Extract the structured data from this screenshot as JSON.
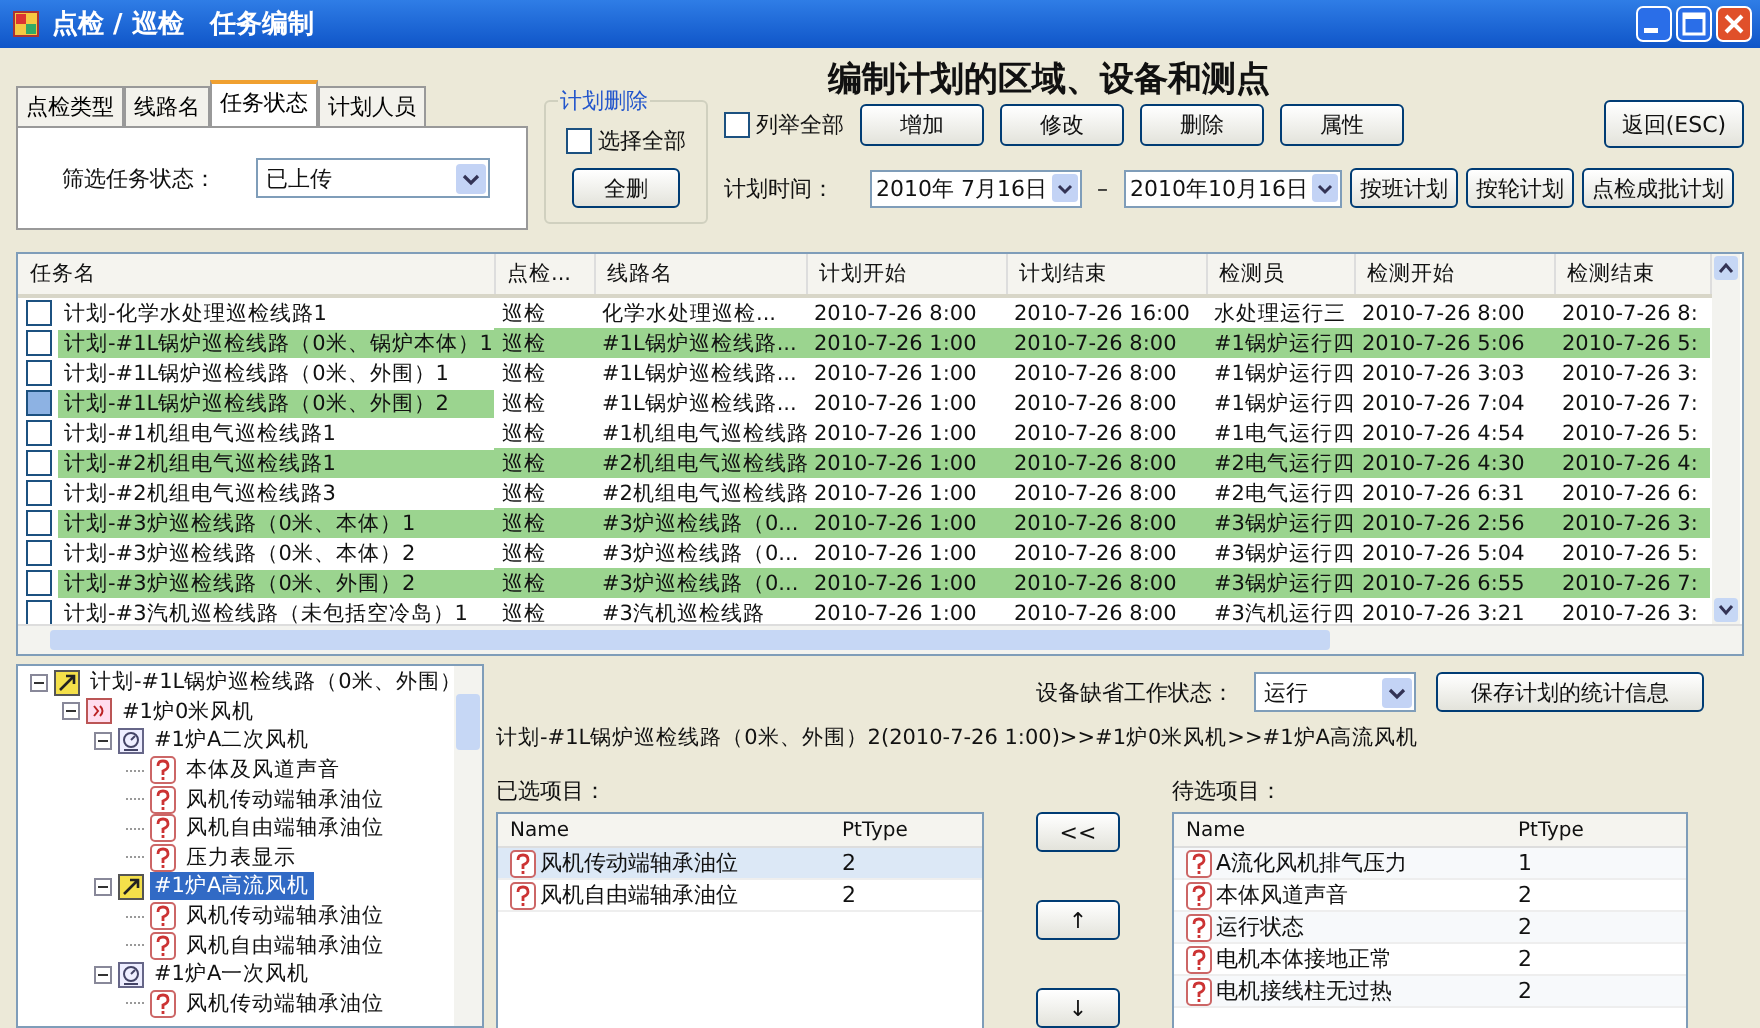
{
  "window": {
    "title": "点检 / 巡检　任务编制"
  },
  "filter_tabs": [
    {
      "label": "点检类型",
      "selected": false
    },
    {
      "label": "线路名",
      "selected": false
    },
    {
      "label": "任务状态",
      "selected": true
    },
    {
      "label": "计划人员",
      "selected": false
    }
  ],
  "filter": {
    "label": "筛选任务状态：",
    "value": "已上传"
  },
  "plan_delete": {
    "title": "计划删除",
    "select_all": {
      "label": "选择全部",
      "checked": false
    },
    "button": "全删"
  },
  "heading": "编制计划的区域、设备和测点",
  "list_all": {
    "label": "列举全部",
    "checked": false
  },
  "actions": [
    "增加",
    "修改",
    "删除",
    "属性"
  ],
  "return_button": "返回(ESC)",
  "plan_time": {
    "label": "计划时间：",
    "from": "2010年 7月16日",
    "separator": "–",
    "to": "2010年10月16日"
  },
  "plan_buttons": [
    "按班计划",
    "按轮计划",
    "点检成批计划"
  ],
  "task_table": {
    "columns": [
      "任务名",
      "点检...",
      "线路名",
      "计划开始",
      "计划结束",
      "检测员",
      "检测开始",
      "检测结束"
    ],
    "rows": [
      {
        "checked": false,
        "highlighted": false,
        "cells": [
          "计划-化学水处理巡检线路1",
          "巡检",
          "化学水处理巡检...",
          "2010-7-26 8:00",
          "2010-7-26 16:00",
          "水处理运行三",
          "2010-7-26 8:00",
          "2010-7-26 8:"
        ]
      },
      {
        "checked": false,
        "highlighted": true,
        "cells": [
          "计划-#1L锅炉巡检线路（0米、锅炉本体）1",
          "巡检",
          "#1L锅炉巡检线路...",
          "2010-7-26 1:00",
          "2010-7-26 8:00",
          "#1锅炉运行四",
          "2010-7-26 5:06",
          "2010-7-26 5:"
        ]
      },
      {
        "checked": false,
        "highlighted": false,
        "cells": [
          "计划-#1L锅炉巡检线路（0米、外围）1",
          "巡检",
          "#1L锅炉巡检线路...",
          "2010-7-26 1:00",
          "2010-7-26 8:00",
          "#1锅炉运行四",
          "2010-7-26 3:03",
          "2010-7-26 3:"
        ]
      },
      {
        "checked": true,
        "highlighted": false,
        "cells": [
          "计划-#1L锅炉巡检线路（0米、外围）2",
          "巡检",
          "#1L锅炉巡检线路...",
          "2010-7-26 1:00",
          "2010-7-26 8:00",
          "#1锅炉运行四",
          "2010-7-26 7:04",
          "2010-7-26 7:"
        ]
      },
      {
        "checked": false,
        "highlighted": false,
        "cells": [
          "计划-#1机组电气巡检线路1",
          "巡检",
          "#1机组电气巡检线路",
          "2010-7-26 1:00",
          "2010-7-26 8:00",
          "#1电气运行四",
          "2010-7-26 4:54",
          "2010-7-26 5:"
        ]
      },
      {
        "checked": false,
        "highlighted": true,
        "cells": [
          "计划-#2机组电气巡检线路1",
          "巡检",
          "#2机组电气巡检线路",
          "2010-7-26 1:00",
          "2010-7-26 8:00",
          "#2电气运行四",
          "2010-7-26 4:30",
          "2010-7-26 4:"
        ]
      },
      {
        "checked": false,
        "highlighted": false,
        "cells": [
          "计划-#2机组电气巡检线路3",
          "巡检",
          "#2机组电气巡检线路",
          "2010-7-26 1:00",
          "2010-7-26 8:00",
          "#2电气运行四",
          "2010-7-26 6:31",
          "2010-7-26 6:"
        ]
      },
      {
        "checked": false,
        "highlighted": true,
        "cells": [
          "计划-#3炉巡检线路（0米、本体）1",
          "巡检",
          "#3炉巡检线路（0...",
          "2010-7-26 1:00",
          "2010-7-26 8:00",
          "#3锅炉运行四",
          "2010-7-26 2:56",
          "2010-7-26 3:"
        ]
      },
      {
        "checked": false,
        "highlighted": false,
        "cells": [
          "计划-#3炉巡检线路（0米、本体）2",
          "巡检",
          "#3炉巡检线路（0...",
          "2010-7-26 1:00",
          "2010-7-26 8:00",
          "#3锅炉运行四",
          "2010-7-26 5:04",
          "2010-7-26 5:"
        ]
      },
      {
        "checked": false,
        "highlighted": true,
        "cells": [
          "计划-#3炉巡检线路（0米、外围）2",
          "巡检",
          "#3炉巡检线路（0...",
          "2010-7-26 1:00",
          "2010-7-26 8:00",
          "#3锅炉运行四",
          "2010-7-26 6:55",
          "2010-7-26 7:"
        ]
      },
      {
        "checked": false,
        "highlighted": false,
        "cells": [
          "计划-#3汽机巡检线路（未包括空冷岛）1",
          "巡检",
          "#3汽机巡检线路",
          "2010-7-26 1:00",
          "2010-7-26 8:00",
          "#3汽机运行四",
          "2010-7-26 3:21",
          "2010-7-26 3:"
        ]
      }
    ]
  },
  "tree": [
    {
      "label": "计划-#1L锅炉巡检线路（0米、外围）",
      "kind": "plan",
      "selected": false,
      "expanded": true,
      "children": [
        {
          "label": "#1炉0米风机",
          "kind": "area",
          "selected": false,
          "expanded": true,
          "children": [
            {
              "label": "#1炉A二次风机",
              "kind": "device",
              "selected": false,
              "expanded": true,
              "children": [
                {
                  "label": "本体及风道声音",
                  "kind": "point",
                  "selected": false
                },
                {
                  "label": "风机传动端轴承油位",
                  "kind": "point",
                  "selected": false
                },
                {
                  "label": "风机自由端轴承油位",
                  "kind": "point",
                  "selected": false
                },
                {
                  "label": "压力表显示",
                  "kind": "point",
                  "selected": false
                }
              ]
            },
            {
              "label": "#1炉A高流风机",
              "kind": "plan",
              "selected": true,
              "expanded": true,
              "children": [
                {
                  "label": "风机传动端轴承油位",
                  "kind": "point",
                  "selected": false
                },
                {
                  "label": "风机自由端轴承油位",
                  "kind": "point",
                  "selected": false
                }
              ]
            },
            {
              "label": "#1炉A一次风机",
              "kind": "device",
              "selected": false,
              "expanded": true,
              "children": [
                {
                  "label": "风机传动端轴承油位",
                  "kind": "point",
                  "selected": false
                }
              ]
            }
          ]
        }
      ]
    }
  ],
  "device_state": {
    "label": "设备缺省工作状态：",
    "value": "运行"
  },
  "save_button": "保存计划的统计信息",
  "path": "计划-#1L锅炉巡检线路（0米、外围）2(2010-7-26 1:00)>>#1炉0米风机>>#1炉A高流风机",
  "selected_items": {
    "label": "已选项目：",
    "columns": [
      "Name",
      "PtType"
    ],
    "rows": [
      {
        "name": "风机传动端轴承油位",
        "pt_type": "2",
        "selected": true
      },
      {
        "name": "风机自由端轴承油位",
        "pt_type": "2",
        "selected": false
      }
    ]
  },
  "move_buttons": [
    "<<",
    "↑",
    "↓"
  ],
  "pending_items": {
    "label": "待选项目：",
    "columns": [
      "Name",
      "PtType"
    ],
    "rows": [
      {
        "name": "A流化风机排气压力",
        "pt_type": "1",
        "selected": false
      },
      {
        "name": "本体风道声音",
        "pt_type": "2",
        "selected": false
      },
      {
        "name": "运行状态",
        "pt_type": "2",
        "selected": false
      },
      {
        "name": "电机本体接地正常",
        "pt_type": "2",
        "selected": false
      },
      {
        "name": "电机接线柱无过热",
        "pt_type": "2",
        "selected": false
      }
    ]
  }
}
